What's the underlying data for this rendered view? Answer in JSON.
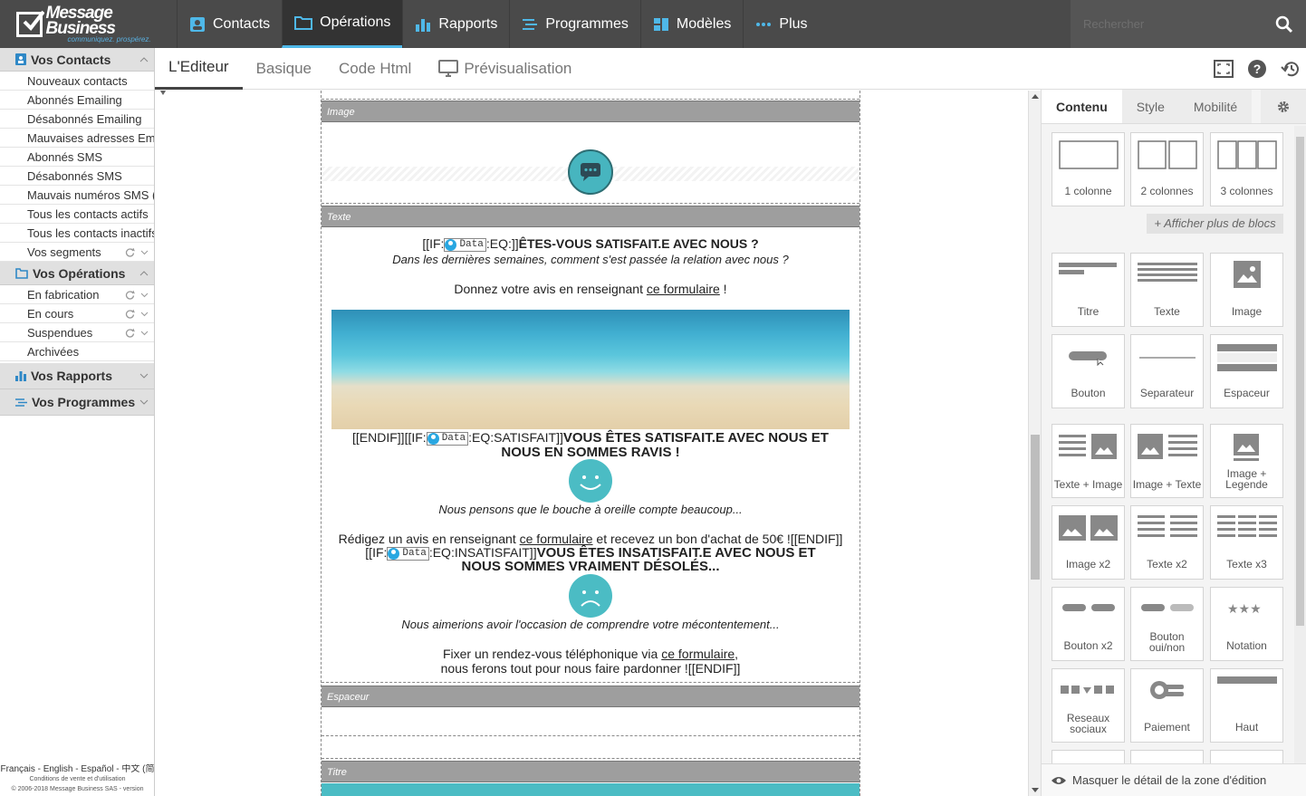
{
  "app": {
    "brand": "Message Business",
    "tagline": "communiquez. prospérez."
  },
  "topnav": {
    "items": [
      {
        "label": "Contacts",
        "icon": "contacts-icon"
      },
      {
        "label": "Opérations",
        "icon": "folder-icon",
        "active": true
      },
      {
        "label": "Rapports",
        "icon": "bar-chart-icon"
      },
      {
        "label": "Programmes",
        "icon": "program-icon"
      },
      {
        "label": "Modèles",
        "icon": "template-icon"
      },
      {
        "label": "Plus",
        "icon": "more-icon"
      }
    ],
    "search_placeholder": "Rechercher"
  },
  "sidebar": {
    "contacts": {
      "title": "Vos Contacts",
      "items": [
        "Nouveaux contacts",
        "Abonnés Emailing",
        "Désabonnés Emailing",
        "Mauvaises adresses Em",
        "Abonnés SMS",
        "Désabonnés SMS",
        "Mauvais numéros SMS (",
        "Tous les contacts actifs",
        "Tous les contacts inactifs",
        "Vos segments"
      ]
    },
    "operations": {
      "title": "Vos Opérations",
      "items": [
        "En fabrication",
        "En cours",
        "Suspendues",
        "Archivées"
      ]
    },
    "rapports": {
      "title": "Vos Rapports"
    },
    "programmes": {
      "title": "Vos Programmes"
    },
    "footer": {
      "langs": "Français - English - Español - 中文 (简",
      "terms": "Conditions de vente et d'utilisation",
      "copyright": "© 2006-2018 Message Business SAS - version"
    }
  },
  "editor_tabs": {
    "items": [
      "L'Editeur",
      "Basique",
      "Code Html",
      "Prévisualisation"
    ],
    "active": "L'Editeur"
  },
  "email": {
    "block_image": "Image",
    "block_texte": "Texte",
    "block_espaceur": "Espaceur",
    "block_titre": "Titre",
    "data_tag": "Data",
    "if_prefix": "[[IF:",
    "if_eq": ":EQ:]]",
    "q_title": "ÊTES-VOUS SATISFAIT.E AVEC NOUS ?",
    "q_sub": "Dans les dernières semaines, comment s'est passée la relation avec nous ?",
    "ask_pre": "Donnez votre avis en renseignant ",
    "ask_link": "ce formulaire",
    "ask_post": " !",
    "endif_if": "[[ENDIF]][[IF:",
    "eq_sat": ":EQ:SATISFAIT]]",
    "sat_title_1": "VOUS ÊTES SATISFAIT.E AVEC NOUS ET",
    "sat_title_2": "NOUS EN SOMMES RAVIS !",
    "sat_sub": "Nous pensons que le bouche à oreille compte beaucoup...",
    "sat_pre": "Rédigez un avis en renseignant ",
    "sat_link": "ce formulaire",
    "sat_post": " et recevez un bon d'achat de 50€ ![[ENDIF]]",
    "eq_insat": ":EQ:INSATISFAIT]]",
    "insat_title_1": "VOUS ÊTES INSATISFAIT.E AVEC NOUS ET",
    "insat_title_2": "NOUS SOMMES VRAIMENT DÉSOLÉS...",
    "insat_sub": "Nous aimerions avoir l'occasion de comprendre votre mécontentement...",
    "insat_pre": "Fixer un rendez-vous téléphonique via ",
    "insat_link": "ce formulaire",
    "insat_post": ",",
    "insat_line2": "nous ferons tout pour nous faire pardonner ![[ENDIF]]"
  },
  "right_panel": {
    "tabs": [
      "Contenu",
      "Style",
      "Mobilité"
    ],
    "active_tab": "Contenu",
    "columns": [
      "1 colonne",
      "2 colonnes",
      "3 colonnes"
    ],
    "more_blocks": "+ Afficher plus de blocs",
    "blocks": [
      [
        "Titre",
        "Texte",
        "Image"
      ],
      [
        "Bouton",
        "Separateur",
        "Espaceur"
      ],
      [
        "Texte + Image",
        "Image + Texte",
        "Image + Legende"
      ],
      [
        "Image x2",
        "Texte x2",
        "Texte x3"
      ],
      [
        "Bouton x2",
        "Bouton oui/non",
        "Notation"
      ],
      [
        "Reseaux sociaux",
        "Paiement",
        "Haut"
      ]
    ],
    "footer": "Masquer le détail de la zone d'édition"
  },
  "colors": {
    "topbar": "#4a4a4a",
    "accent": "#4fb8e8",
    "teal": "#4bbcc4",
    "block_bar": "#9e9e9e"
  }
}
